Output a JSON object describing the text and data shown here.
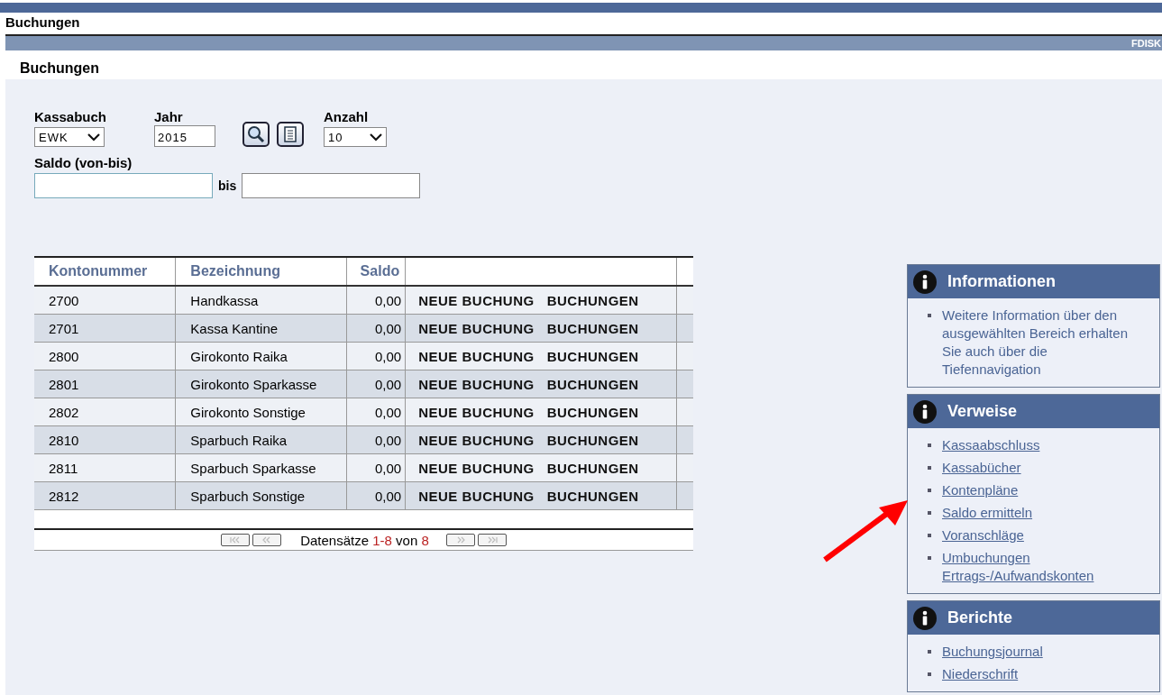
{
  "window": {
    "title": "Buchungen"
  },
  "brand": "FDISK",
  "section_title": "Buchungen",
  "filters": {
    "kassabuch": {
      "label": "Kassabuch",
      "value": "EWK"
    },
    "jahr": {
      "label": "Jahr",
      "value": "2015"
    },
    "anzahl": {
      "label": "Anzahl",
      "value": "10"
    },
    "saldo": {
      "label": "Saldo (von-bis)",
      "separator": "bis"
    }
  },
  "table": {
    "columns": [
      "Kontonummer",
      "Bezeichnung",
      "Saldo"
    ],
    "rows": [
      {
        "cells": [
          "2700",
          "Handkassa",
          "0,00"
        ],
        "actions": [
          "NEUE BUCHUNG",
          "BUCHUNGEN"
        ]
      },
      {
        "cells": [
          "2701",
          "Kassa Kantine",
          "0,00"
        ],
        "actions": [
          "NEUE BUCHUNG",
          "BUCHUNGEN"
        ]
      },
      {
        "cells": [
          "2800",
          "Girokonto Raika",
          "0,00"
        ],
        "actions": [
          "NEUE BUCHUNG",
          "BUCHUNGEN"
        ]
      },
      {
        "cells": [
          "2801",
          "Girokonto Sparkasse",
          "0,00"
        ],
        "actions": [
          "NEUE BUCHUNG",
          "BUCHUNGEN"
        ]
      },
      {
        "cells": [
          "2802",
          "Girokonto Sonstige",
          "0,00"
        ],
        "actions": [
          "NEUE BUCHUNG",
          "BUCHUNGEN"
        ]
      },
      {
        "cells": [
          "2810",
          "Sparbuch Raika",
          "0,00"
        ],
        "actions": [
          "NEUE BUCHUNG",
          "BUCHUNGEN"
        ]
      },
      {
        "cells": [
          "2811",
          "Sparbuch Sparkasse",
          "0,00"
        ],
        "actions": [
          "NEUE BUCHUNG",
          "BUCHUNGEN"
        ]
      },
      {
        "cells": [
          "2812",
          "Sparbuch Sonstige",
          "0,00"
        ],
        "actions": [
          "NEUE BUCHUNG",
          "BUCHUNGEN"
        ]
      }
    ],
    "pager": {
      "label": "Datensätze",
      "range": "1-8",
      "of": "von",
      "total": "8",
      "disabled": true
    }
  },
  "sidebar": [
    {
      "title": "Informationen",
      "items": [
        {
          "kind": "text",
          "text": "Weitere Information über den ausgewählten Bereich erhalten Sie auch über die Tiefennavigation"
        }
      ]
    },
    {
      "title": "Verweise",
      "items": [
        {
          "kind": "link",
          "text": "Kassaabschluss"
        },
        {
          "kind": "link",
          "text": "Kassabücher"
        },
        {
          "kind": "link",
          "text": "Kontenpläne"
        },
        {
          "kind": "link",
          "text": "Saldo ermitteln"
        },
        {
          "kind": "link",
          "text": "Voranschläge"
        },
        {
          "kind": "link",
          "text": "Umbuchungen Ertrags-/Aufwandskonten"
        }
      ]
    },
    {
      "title": "Berichte",
      "items": [
        {
          "kind": "link",
          "text": "Buchungsjournal"
        },
        {
          "kind": "link",
          "text": "Niederschrift"
        }
      ]
    }
  ]
}
